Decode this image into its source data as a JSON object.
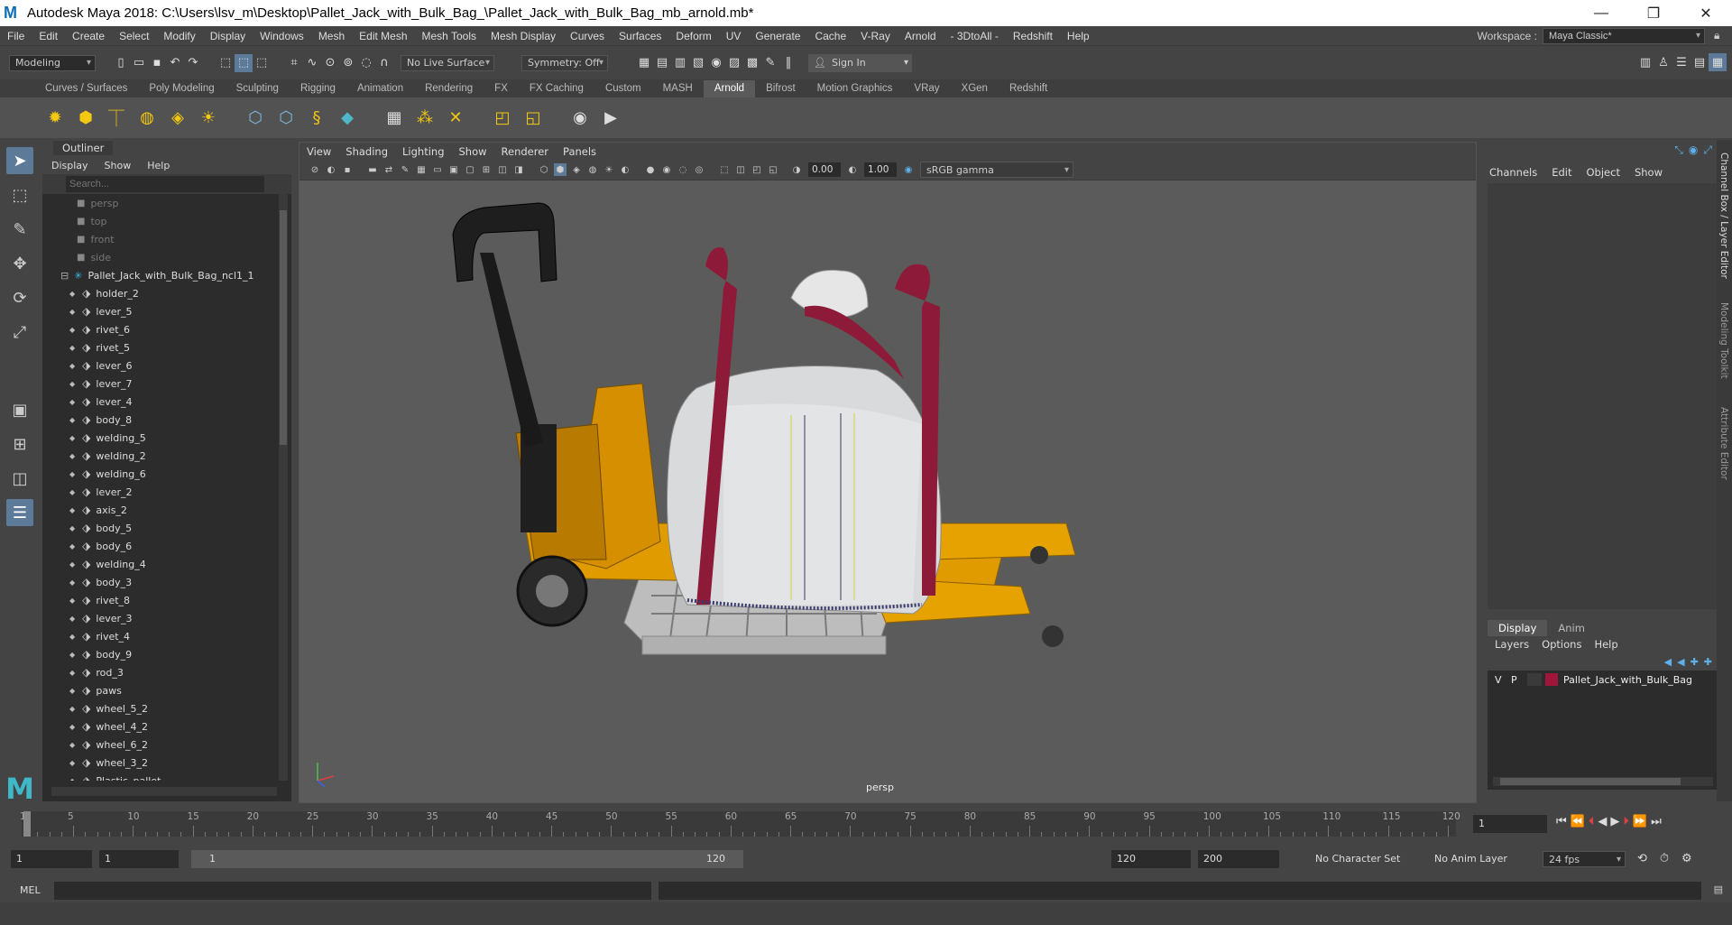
{
  "window": {
    "title": "Autodesk Maya 2018: C:\\Users\\lsv_m\\Desktop\\Pallet_Jack_with_Bulk_Bag_\\Pallet_Jack_with_Bulk_Bag_mb_arnold.mb*",
    "logo": "M"
  },
  "menubar": {
    "items": [
      "File",
      "Edit",
      "Create",
      "Select",
      "Modify",
      "Display",
      "Windows",
      "Mesh",
      "Edit Mesh",
      "Mesh Tools",
      "Mesh Display",
      "Curves",
      "Surfaces",
      "Deform",
      "UV",
      "Generate",
      "Cache",
      "V-Ray",
      "Arnold",
      "- 3DtoAll -",
      "Redshift",
      "Help"
    ],
    "workspace_label": "Workspace :",
    "workspace_value": "Maya Classic*"
  },
  "statusline": {
    "mode": "Modeling",
    "live_surface": "No Live Surface",
    "symmetry": "Symmetry: Off",
    "sign_in": "Sign In"
  },
  "shelf": {
    "tabs": [
      "Curves / Surfaces",
      "Poly Modeling",
      "Sculpting",
      "Rigging",
      "Animation",
      "Rendering",
      "FX",
      "FX Caching",
      "Custom",
      "MASH",
      "Arnold",
      "Bifrost",
      "Motion Graphics",
      "VRay",
      "XGen",
      "Redshift"
    ],
    "active_tab": "Arnold"
  },
  "outliner": {
    "title": "Outliner",
    "menu": [
      "Display",
      "Show",
      "Help"
    ],
    "search_placeholder": "Search...",
    "cameras": [
      "persp",
      "top",
      "front",
      "side"
    ],
    "group": "Pallet_Jack_with_Bulk_Bag_ncl1_1",
    "items": [
      "holder_2",
      "lever_5",
      "rivet_6",
      "rivet_5",
      "lever_6",
      "lever_7",
      "lever_4",
      "body_8",
      "welding_5",
      "welding_2",
      "welding_6",
      "lever_2",
      "axis_2",
      "body_5",
      "body_6",
      "welding_4",
      "body_3",
      "rivet_8",
      "lever_3",
      "rivet_4",
      "body_9",
      "rod_3",
      "paws",
      "wheel_5_2",
      "wheel_4_2",
      "wheel_6_2",
      "wheel_3_2",
      "Plastic_pallet"
    ]
  },
  "viewport": {
    "menu": [
      "View",
      "Shading",
      "Lighting",
      "Show",
      "Renderer",
      "Panels"
    ],
    "exposure": "0.00",
    "gamma": "1.00",
    "color_space": "sRGB gamma",
    "camera_label": "persp"
  },
  "channelbox": {
    "menu": [
      "Channels",
      "Edit",
      "Object",
      "Show"
    ],
    "layer_tabs": [
      "Display",
      "Anim"
    ],
    "layer_menu": [
      "Layers",
      "Options",
      "Help"
    ],
    "layer": {
      "v": "V",
      "p": "P",
      "name": "Pallet_Jack_with_Bulk_Bag",
      "color": "#a0153a"
    },
    "side_tabs": [
      "Channel Box / Layer Editor",
      "Modeling Toolkit",
      "Attribute Editor"
    ]
  },
  "timeline": {
    "ticks": [
      "1",
      "5",
      "10",
      "15",
      "20",
      "25",
      "30",
      "35",
      "40",
      "45",
      "50",
      "55",
      "60",
      "65",
      "70",
      "75",
      "80",
      "85",
      "90",
      "95",
      "100",
      "105",
      "110",
      "115",
      "120"
    ],
    "current_frame": "1"
  },
  "range": {
    "start": "1",
    "anim_start": "1",
    "range_start": "1",
    "range_end": "120",
    "end": "120",
    "anim_end": "200",
    "character_set": "No Character Set",
    "anim_layer": "No Anim Layer",
    "fps": "24 fps"
  },
  "cmdline": {
    "label": "MEL"
  },
  "colors": {
    "accent": "#5d7a99",
    "pallet_jack": "#e09b00",
    "bag_strap": "#8e1a3a"
  }
}
